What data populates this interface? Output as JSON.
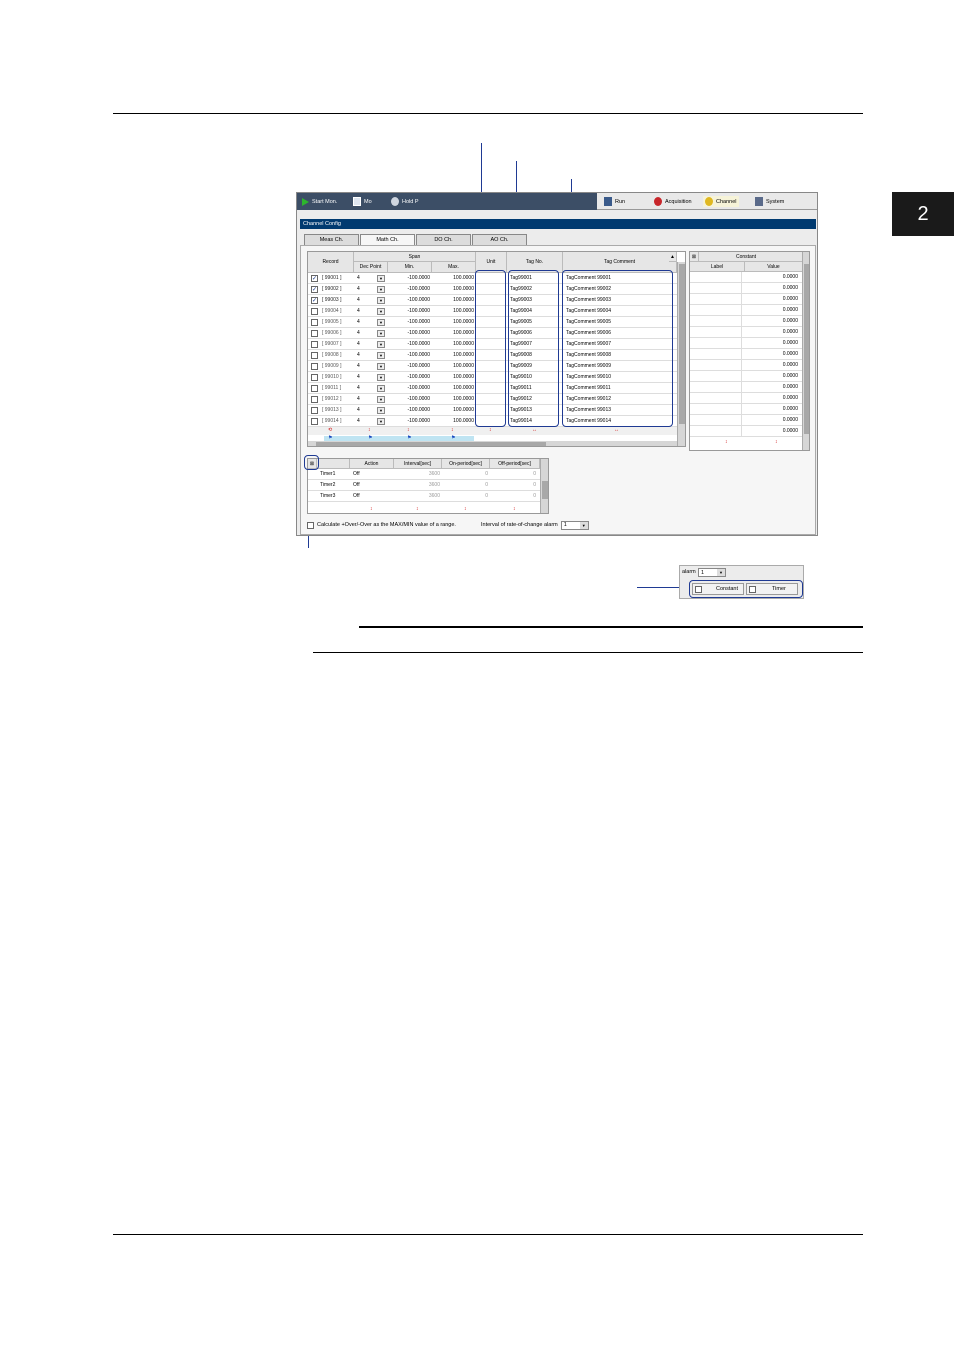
{
  "chapter": "2",
  "toolbar": {
    "start_mon": "Start Mon.",
    "item2": "Mo",
    "item3": "Hold P",
    "run": "Run",
    "acquisition": "Acquisition",
    "channel": "Channel",
    "system": "System"
  },
  "window_title": "Channel Config",
  "tabs": [
    "Meas Ch.",
    "Math Ch.",
    "DO Ch.",
    "AO Ch."
  ],
  "headers": {
    "record": "Record",
    "span": "Span",
    "dec_point": "Dec Point",
    "min": "Min.",
    "max": "Max.",
    "unit": "Unit",
    "tag_no": "Tag No.",
    "tag_comment": "Tag Comment"
  },
  "rows": [
    {
      "checked": true,
      "ch": "[ 99001 ]",
      "dec": "4",
      "min": "-100.0000",
      "max": "100.0000",
      "unit": "",
      "tag": "Tag99001",
      "comment": "TagComment 99001"
    },
    {
      "checked": true,
      "ch": "[ 99002 ]",
      "dec": "4",
      "min": "-100.0000",
      "max": "100.0000",
      "unit": "",
      "tag": "Tag99002",
      "comment": "TagComment 99002"
    },
    {
      "checked": true,
      "ch": "[ 99003 ]",
      "dec": "4",
      "min": "-100.0000",
      "max": "100.0000",
      "unit": "",
      "tag": "Tag99003",
      "comment": "TagComment 99003"
    },
    {
      "checked": false,
      "ch": "[ 99004 ]",
      "dec": "4",
      "min": "-100.0000",
      "max": "100.0000",
      "unit": "",
      "tag": "Tag99004",
      "comment": "TagComment 99004"
    },
    {
      "checked": false,
      "ch": "[ 99005 ]",
      "dec": "4",
      "min": "-100.0000",
      "max": "100.0000",
      "unit": "",
      "tag": "Tag99005",
      "comment": "TagComment 99005"
    },
    {
      "checked": false,
      "ch": "[ 99006 ]",
      "dec": "4",
      "min": "-100.0000",
      "max": "100.0000",
      "unit": "",
      "tag": "Tag99006",
      "comment": "TagComment 99006"
    },
    {
      "checked": false,
      "ch": "[ 99007 ]",
      "dec": "4",
      "min": "-100.0000",
      "max": "100.0000",
      "unit": "",
      "tag": "Tag99007",
      "comment": "TagComment 99007"
    },
    {
      "checked": false,
      "ch": "[ 99008 ]",
      "dec": "4",
      "min": "-100.0000",
      "max": "100.0000",
      "unit": "",
      "tag": "Tag99008",
      "comment": "TagComment 99008"
    },
    {
      "checked": false,
      "ch": "[ 99009 ]",
      "dec": "4",
      "min": "-100.0000",
      "max": "100.0000",
      "unit": "",
      "tag": "Tag99009",
      "comment": "TagComment 99009"
    },
    {
      "checked": false,
      "ch": "[ 99010 ]",
      "dec": "4",
      "min": "-100.0000",
      "max": "100.0000",
      "unit": "",
      "tag": "Tag99010",
      "comment": "TagComment 99010"
    },
    {
      "checked": false,
      "ch": "[ 99011 ]",
      "dec": "4",
      "min": "-100.0000",
      "max": "100.0000",
      "unit": "",
      "tag": "Tag99011",
      "comment": "TagComment 99011"
    },
    {
      "checked": false,
      "ch": "[ 99012 ]",
      "dec": "4",
      "min": "-100.0000",
      "max": "100.0000",
      "unit": "",
      "tag": "Tag99012",
      "comment": "TagComment 99012"
    },
    {
      "checked": false,
      "ch": "[ 99013 ]",
      "dec": "4",
      "min": "-100.0000",
      "max": "100.0000",
      "unit": "",
      "tag": "Tag99013",
      "comment": "TagComment 99013"
    },
    {
      "checked": false,
      "ch": "[ 99014 ]",
      "dec": "4",
      "min": "-100.0000",
      "max": "100.0000",
      "unit": "",
      "tag": "Tag99014",
      "comment": "TagComment 99014"
    }
  ],
  "constant": {
    "title": "Constant",
    "label_header": "Label",
    "value_header": "Value",
    "values": [
      "0.0000",
      "0.0000",
      "0.0000",
      "0.0000",
      "0.0000",
      "0.0000",
      "0.0000",
      "0.0000",
      "0.0000",
      "0.0000",
      "0.0000",
      "0.0000",
      "0.0000",
      "0.0000",
      "0.0000"
    ]
  },
  "timer": {
    "headers": {
      "action": "Action",
      "interval": "Interval[sec]",
      "on_period": "On-period[sec]",
      "off_period": "Off-period[sec]"
    },
    "rows": [
      {
        "name": "Timer1",
        "action": "Off",
        "interval": "3600",
        "on": "0",
        "off": "0"
      },
      {
        "name": "Timer2",
        "action": "Off",
        "interval": "3600",
        "on": "0",
        "off": "0"
      },
      {
        "name": "Timer3",
        "action": "Off",
        "interval": "3600",
        "on": "0",
        "off": "0"
      }
    ]
  },
  "bottom": {
    "calc_label": "Calculate +Over/-Over as the MAX/MIN value of a range.",
    "interval_label": "Interval of rate-of-change alarm",
    "interval_value": "1"
  },
  "inset": {
    "alarm_label": "alarm",
    "alarm_value": "1",
    "constant_button": "Constant",
    "timer_button": "Timer"
  }
}
